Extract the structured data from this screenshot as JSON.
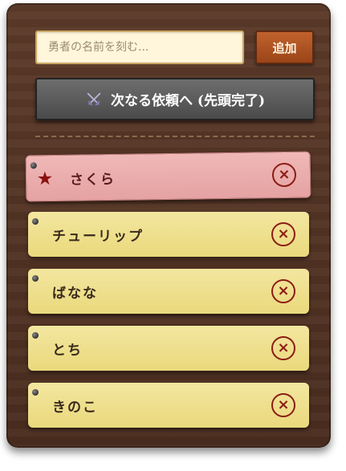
{
  "form": {
    "name_placeholder": "勇者の名前を刻む...",
    "add_label": "追加"
  },
  "next_quest": {
    "label": "次なる依頼へ (先頭完了)",
    "icon": "crossed-swords-icon"
  },
  "queue": [
    {
      "name": "さくら",
      "active": true,
      "marker": "★"
    },
    {
      "name": "チューリップ",
      "active": false
    },
    {
      "name": "ばなな",
      "active": false
    },
    {
      "name": "とち",
      "active": false
    },
    {
      "name": "きのこ",
      "active": false
    }
  ],
  "remove_glyph": "×",
  "colors": {
    "board": "#4b2e20",
    "add_button": "#9b4519",
    "active_card": "#e5a2a2",
    "card": "#ead97c",
    "remove": "#8b1d14"
  }
}
